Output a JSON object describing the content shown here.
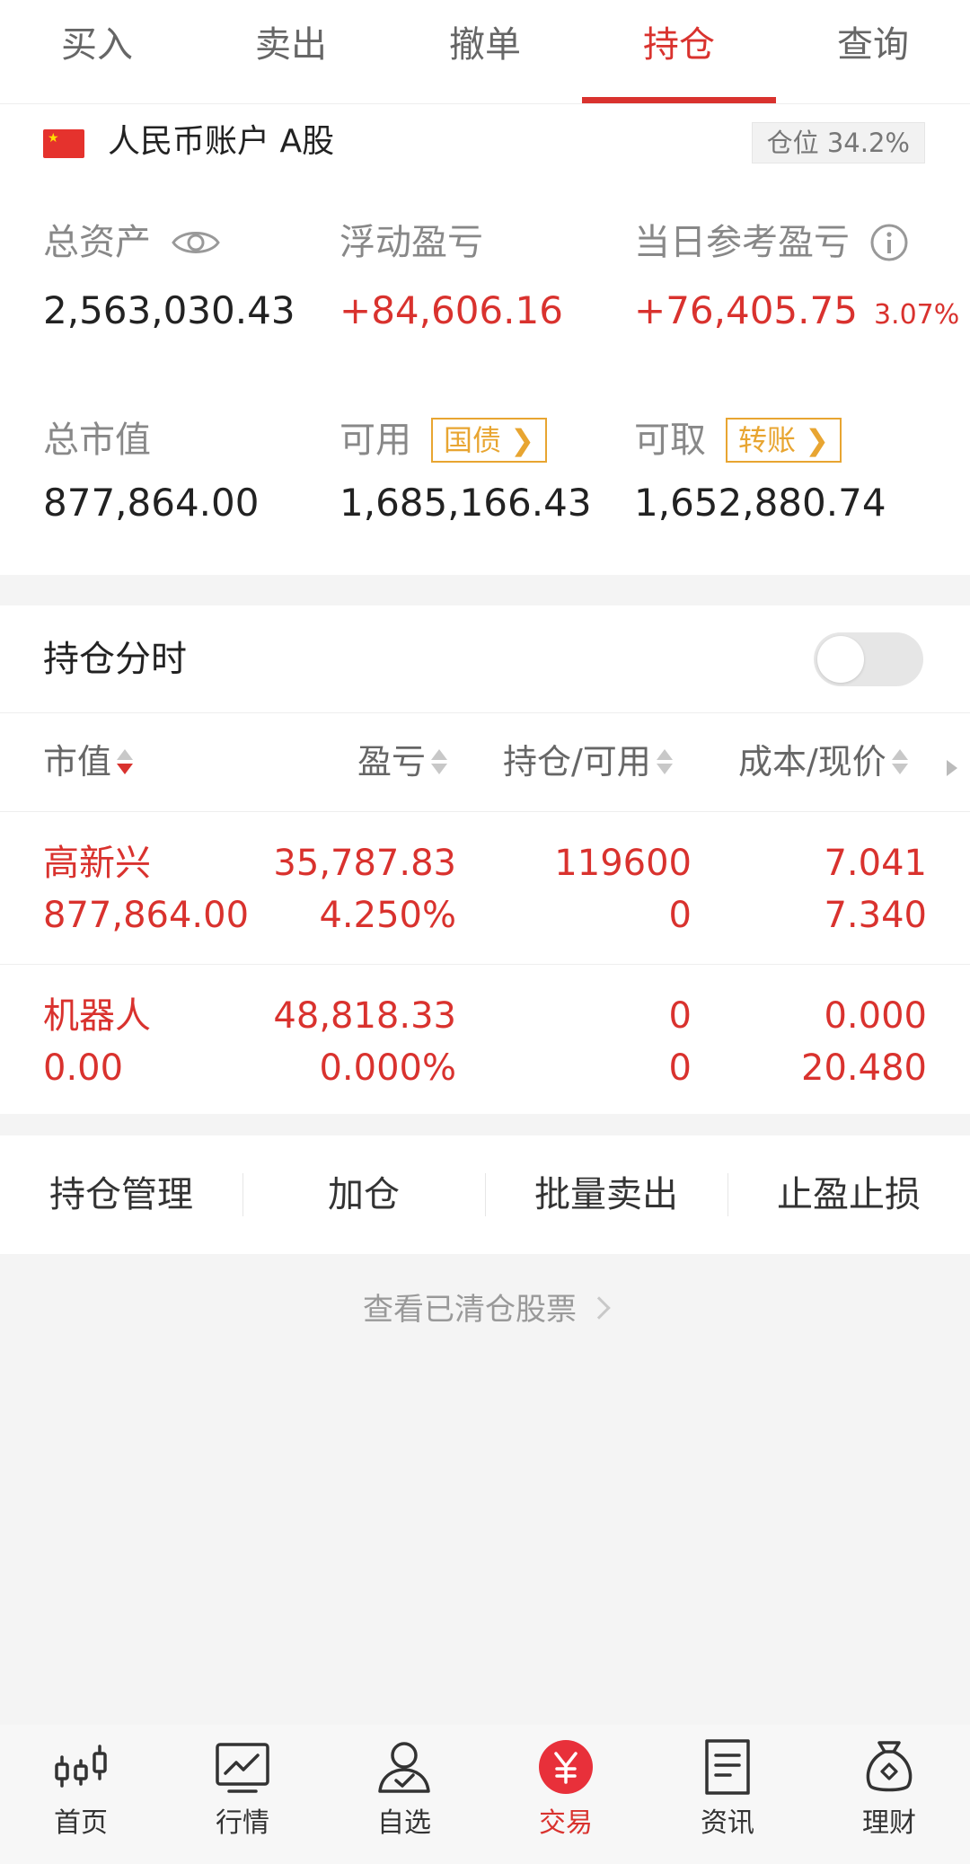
{
  "tabs": [
    {
      "label": "买入"
    },
    {
      "label": "卖出"
    },
    {
      "label": "撤单"
    },
    {
      "label": "持仓"
    },
    {
      "label": "查询"
    }
  ],
  "active_tab": "持仓",
  "account": {
    "name": "人民币账户 A股",
    "position_label": "仓位",
    "position_value": "34.2%"
  },
  "summary": {
    "total_assets_label": "总资产",
    "total_assets": "2,563,030.43",
    "floating_pnl_label": "浮动盈亏",
    "floating_pnl": "+84,606.16",
    "daily_pnl_label": "当日参考盈亏",
    "daily_pnl": "+76,405.75",
    "daily_pnl_pct": "3.07%",
    "market_value_label": "总市值",
    "market_value": "877,864.00",
    "available_label": "可用",
    "available": "1,685,166.43",
    "bond_button": "国债",
    "withdrawable_label": "可取",
    "withdrawable": "1,652,880.74",
    "transfer_button": "转账"
  },
  "positions": {
    "title": "持仓分时",
    "toggle_on": false,
    "columns": [
      "市值",
      "盈亏",
      "持仓/可用",
      "成本/现价"
    ],
    "rows": [
      {
        "name": "高新兴",
        "market_value": "877,864.00",
        "pnl": "35,787.83",
        "pnl_pct": "4.250%",
        "holding": "119600",
        "available": "0",
        "cost": "7.041",
        "price": "7.340"
      },
      {
        "name": "机器人",
        "market_value": "0.00",
        "pnl": "48,818.33",
        "pnl_pct": "0.000%",
        "holding": "0",
        "available": "0",
        "cost": "0.000",
        "price": "20.480"
      }
    ]
  },
  "actions": [
    "持仓管理",
    "加仓",
    "批量卖出",
    "止盈止损"
  ],
  "cleared_link": "查看已清仓股票",
  "bottom_nav": [
    {
      "label": "首页",
      "icon": "candlestick-icon"
    },
    {
      "label": "行情",
      "icon": "chart-icon"
    },
    {
      "label": "自选",
      "icon": "user-check-icon"
    },
    {
      "label": "交易",
      "icon": "yuan-icon"
    },
    {
      "label": "资讯",
      "icon": "document-icon"
    },
    {
      "label": "理财",
      "icon": "money-bag-icon"
    }
  ],
  "colors": {
    "accent": "#d9322e",
    "tag": "#e8a531"
  }
}
